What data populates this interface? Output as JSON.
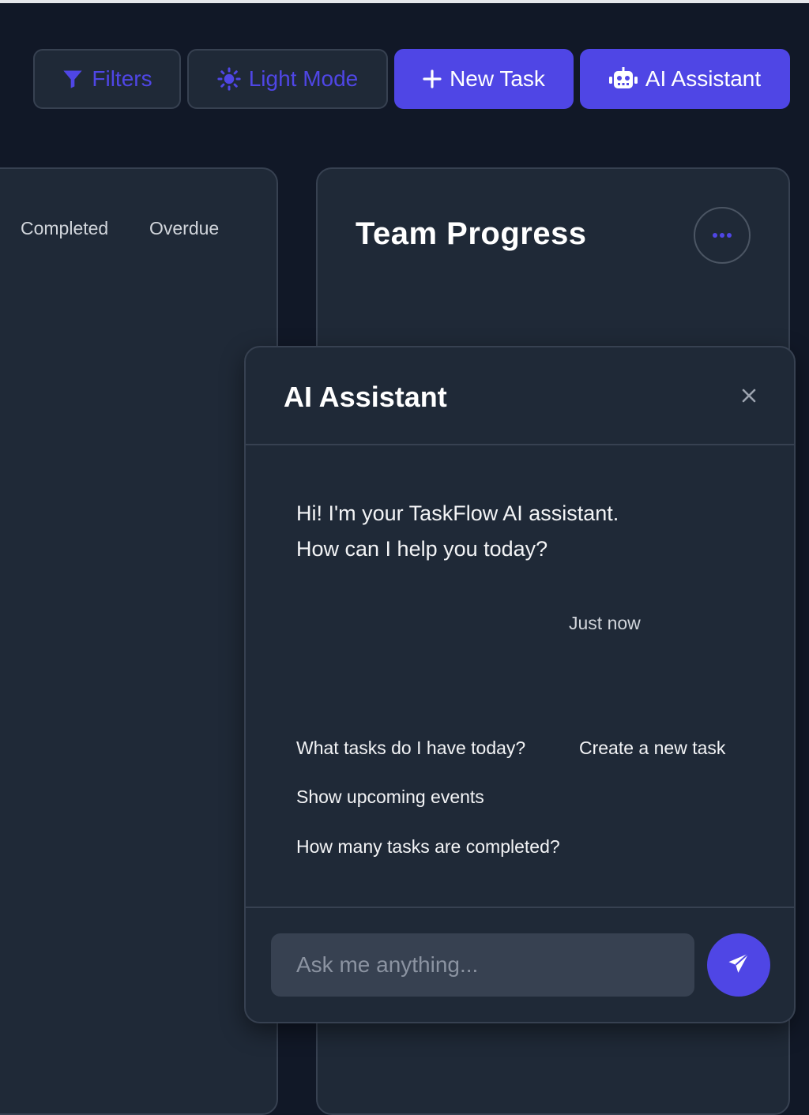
{
  "toolbar": {
    "filters_label": "Filters",
    "filters_icon": "filter-icon",
    "light_mode_label": "Light Mode",
    "light_mode_icon": "sun-icon",
    "new_task_label": "New Task",
    "new_task_icon": "plus-icon",
    "ai_assistant_label": "AI Assistant",
    "ai_assistant_icon": "robot-icon"
  },
  "left_card": {
    "legend": [
      "Completed",
      "Overdue"
    ]
  },
  "team_progress": {
    "title": "Team Progress",
    "menu_icon": "more-dots-icon"
  },
  "ai_panel": {
    "title": "AI Assistant",
    "close_icon": "close-icon",
    "message": "Hi! I'm your TaskFlow AI assistant. How can I help you today?",
    "message_time": "Just now",
    "suggestions": [
      "What tasks do I have today?",
      "Create a new task",
      "Show upcoming events",
      "How many tasks are completed?"
    ],
    "input_placeholder": "Ask me anything...",
    "send_icon": "paper-plane-icon"
  },
  "colors": {
    "background": "#111827",
    "surface": "#1f2937",
    "border": "#374151",
    "accent": "#4f46e5"
  }
}
